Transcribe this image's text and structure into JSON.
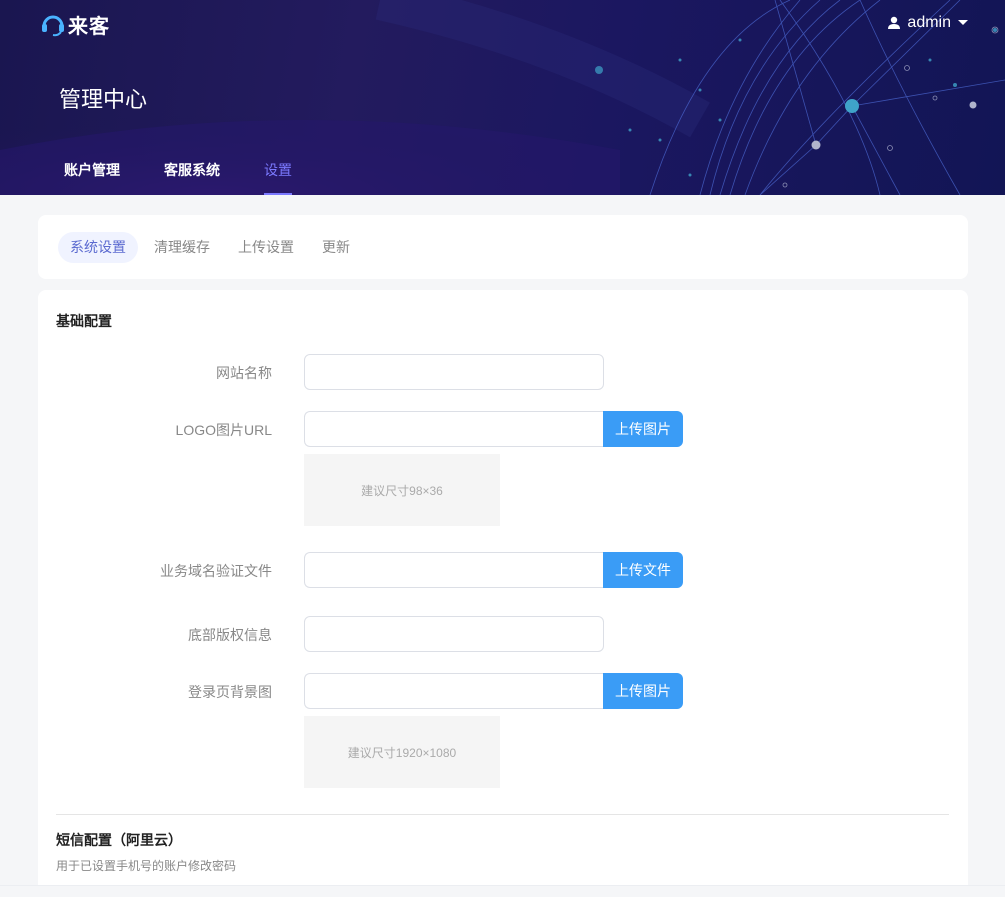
{
  "brand": {
    "name": "来客"
  },
  "user": {
    "name": "admin"
  },
  "header": {
    "title": "管理中心"
  },
  "nav": [
    {
      "label": "账户管理",
      "active": false
    },
    {
      "label": "客服系统",
      "active": false
    },
    {
      "label": "设置",
      "active": true
    }
  ],
  "subtabs": [
    {
      "label": "系统设置",
      "active": true
    },
    {
      "label": "清理缓存",
      "active": false
    },
    {
      "label": "上传设置",
      "active": false
    },
    {
      "label": "更新",
      "active": false
    }
  ],
  "basic": {
    "title": "基础配置",
    "site_name": {
      "label": "网站名称",
      "value": ""
    },
    "logo": {
      "label": "LOGO图片URL",
      "value": "",
      "button": "上传图片",
      "hint": "建议尺寸98×36"
    },
    "domain_file": {
      "label": "业务域名验证文件",
      "value": "",
      "button": "上传文件"
    },
    "copyright": {
      "label": "底部版权信息",
      "value": ""
    },
    "login_bg": {
      "label": "登录页背景图",
      "value": "",
      "button": "上传图片",
      "hint": "建议尺寸1920×1080"
    }
  },
  "sms": {
    "title": "短信配置（阿里云）",
    "desc": "用于已设置手机号的账户修改密码"
  },
  "colors": {
    "accent": "#7b79ff",
    "button": "#3a9cf6",
    "banner": "#1a1650"
  }
}
